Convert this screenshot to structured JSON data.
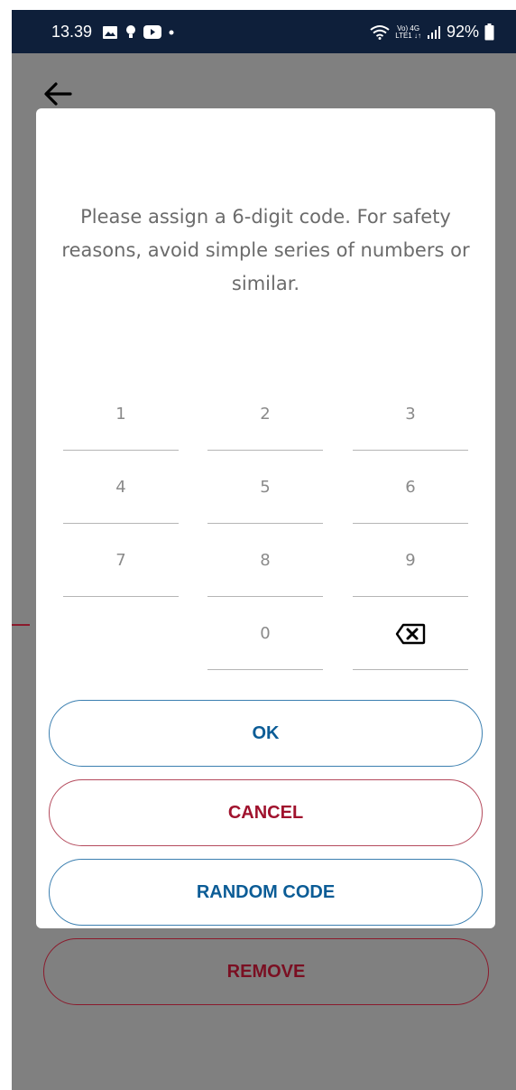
{
  "status_bar": {
    "time": "13.39",
    "battery": "92%",
    "net_top": "Vo) 4G",
    "net_bottom": "LTE1 ↓↑",
    "icons": [
      "gallery-icon",
      "bulb-icon",
      "youtube-icon",
      "dot-icon",
      "wifi-icon",
      "signal-icon",
      "battery-icon"
    ]
  },
  "page": {
    "back_icon": "back-arrow-icon",
    "remove_label": "REMOVE"
  },
  "dialog": {
    "instructions": "Please assign a 6-digit code. For safety reasons, avoid simple series of numbers or similar.",
    "keys": {
      "k1": "1",
      "k2": "2",
      "k3": "3",
      "k4": "4",
      "k5": "5",
      "k6": "6",
      "k7": "7",
      "k8": "8",
      "k9": "9",
      "k0": "0"
    },
    "backspace_icon": "backspace-icon",
    "ok_label": "OK",
    "cancel_label": "CANCEL",
    "random_label": "RANDOM CODE"
  },
  "colors": {
    "status_bar_bg": "#0e1f3a",
    "overlay": "#808080",
    "primary_blue": "#0b5c96",
    "accent_red": "#a0122d"
  }
}
